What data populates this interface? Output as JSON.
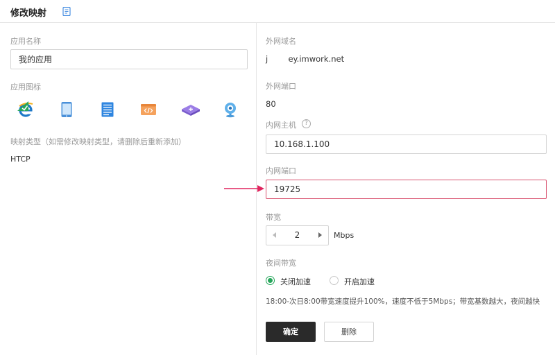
{
  "header": {
    "title": "修改映射",
    "doc_icon": "document-icon"
  },
  "left": {
    "app_name_label": "应用名称",
    "app_name_value": "我的应用",
    "app_icon_label": "应用图标",
    "icons": [
      {
        "name": "ie-browser-icon",
        "selected": true
      },
      {
        "name": "tablet-icon",
        "selected": false
      },
      {
        "name": "document-list-icon",
        "selected": false
      },
      {
        "name": "code-window-icon",
        "selected": false
      },
      {
        "name": "network-device-icon",
        "selected": false
      },
      {
        "name": "webcam-icon",
        "selected": false
      }
    ],
    "mapping_type_label": "映射类型（如需修改映射类型，请删除后重新添加）",
    "mapping_type_value": "HTCP"
  },
  "right": {
    "domain_label": "外网域名",
    "domain_value": "j        ey.imwork.net",
    "ext_port_label": "外网端口",
    "ext_port_value": "80",
    "int_host_label": "内网主机",
    "int_host_value": "10.168.1.100",
    "int_port_label": "内网端口",
    "int_port_value": "19725",
    "bandwidth_label": "带宽",
    "bandwidth_value": "2",
    "bandwidth_unit": "Mbps",
    "night_label": "夜间带宽",
    "night_options": [
      {
        "label": "关闭加速",
        "selected": true
      },
      {
        "label": "开启加速",
        "selected": false
      }
    ],
    "night_note": "18:00-次日8:00带宽速度提升100%，速度不低于5Mbps；带宽基数越大，夜间越快",
    "confirm_label": "确定",
    "delete_label": "删除"
  },
  "colors": {
    "accent_green": "#26a65b",
    "primary_button": "#2a2a2a",
    "highlight_border": "#d9516e",
    "arrow": "#e0245e"
  }
}
